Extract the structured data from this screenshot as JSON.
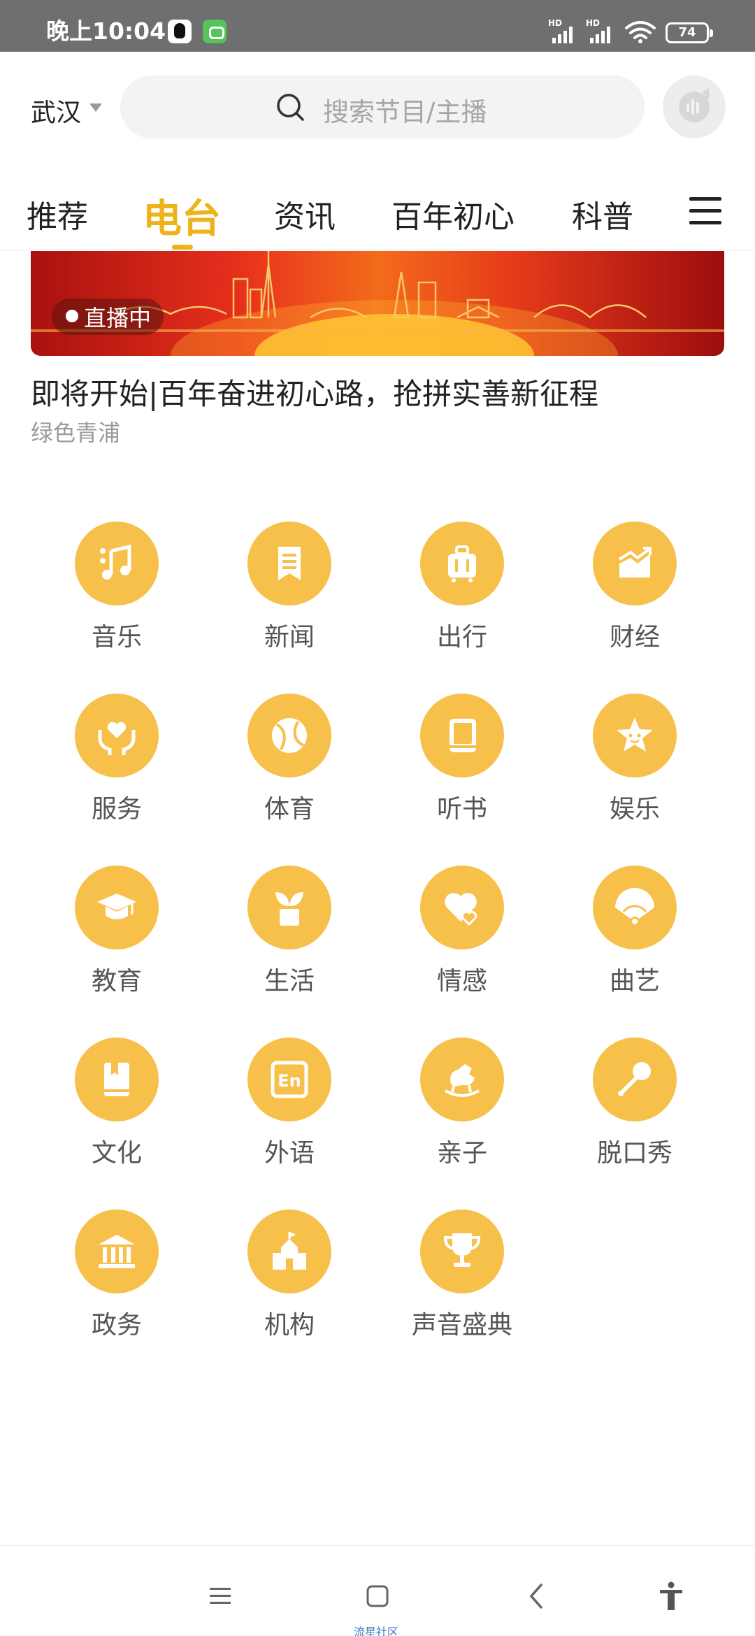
{
  "status_bar": {
    "time": "晚上10:04",
    "hd_label": "HD",
    "battery_level": "74"
  },
  "header": {
    "city": "武汉",
    "search_placeholder": "搜索节目/主播"
  },
  "tabs": [
    {
      "label": "推荐",
      "active": false
    },
    {
      "label": "电台",
      "active": true
    },
    {
      "label": "资讯",
      "active": false
    },
    {
      "label": "百年初心",
      "active": false
    },
    {
      "label": "科普",
      "active": false
    }
  ],
  "banner": {
    "live_label": "直播中",
    "title": "即将开始|百年奋进初心路，抢拼实善新征程",
    "subtitle": "绿色青浦"
  },
  "categories": [
    {
      "label": "音乐",
      "icon": "music-note-icon"
    },
    {
      "label": "新闻",
      "icon": "news-icon"
    },
    {
      "label": "出行",
      "icon": "suitcase-icon"
    },
    {
      "label": "财经",
      "icon": "finance-chart-icon"
    },
    {
      "label": "服务",
      "icon": "heart-hands-icon"
    },
    {
      "label": "体育",
      "icon": "ball-icon"
    },
    {
      "label": "听书",
      "icon": "book-icon"
    },
    {
      "label": "娱乐",
      "icon": "star-icon"
    },
    {
      "label": "教育",
      "icon": "graduation-cap-icon"
    },
    {
      "label": "生活",
      "icon": "plant-pot-icon"
    },
    {
      "label": "情感",
      "icon": "double-heart-icon"
    },
    {
      "label": "曲艺",
      "icon": "fan-icon"
    },
    {
      "label": "文化",
      "icon": "bookmark-book-icon"
    },
    {
      "label": "外语",
      "icon": "english-icon"
    },
    {
      "label": "亲子",
      "icon": "rocking-horse-icon"
    },
    {
      "label": "脱口秀",
      "icon": "microphone-icon"
    },
    {
      "label": "政务",
      "icon": "government-building-icon"
    },
    {
      "label": "机构",
      "icon": "institution-icon"
    },
    {
      "label": "声音盛典",
      "icon": "trophy-icon"
    }
  ],
  "english_icon_text": "En",
  "bottom_nav": {
    "watermark": "流星社区"
  },
  "colors": {
    "accent": "#f0b21a",
    "category_circle": "#f7c04a",
    "status_bar": "#6f6f6f"
  }
}
